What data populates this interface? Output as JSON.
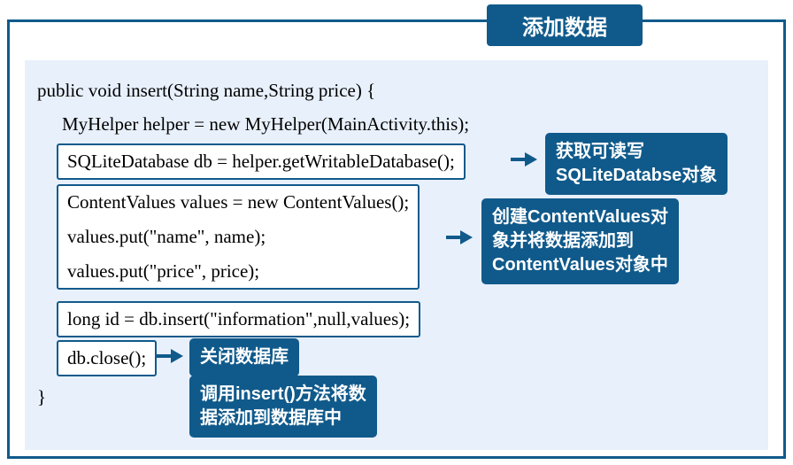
{
  "title": "添加数据",
  "code": {
    "line1": "public void insert(String name,String price) {",
    "line2": "MyHelper helper = new MyHelper(MainActivity.this);",
    "box1": "SQLiteDatabase db = helper.getWritableDatabase();",
    "box2_line1": "ContentValues values = new ContentValues();",
    "box2_line2": "values.put(\"name\", name);",
    "box2_line3": " values.put(\"price\", price);",
    "box3": " long id = db.insert(\"information\",null,values);",
    "box4": " db.close();",
    "line_end": "}"
  },
  "callouts": {
    "c1_line1": "获取可读写",
    "c1_line2": "SQLiteDatabse对象",
    "c2_line1": "创建ContentValues对",
    "c2_line2": "象并将数据添加到",
    "c2_line3": "ContentValues对象中",
    "c3": "关闭数据库",
    "c4_line1": "调用insert()方法将数",
    "c4_line2": "据添加到数据库中"
  }
}
